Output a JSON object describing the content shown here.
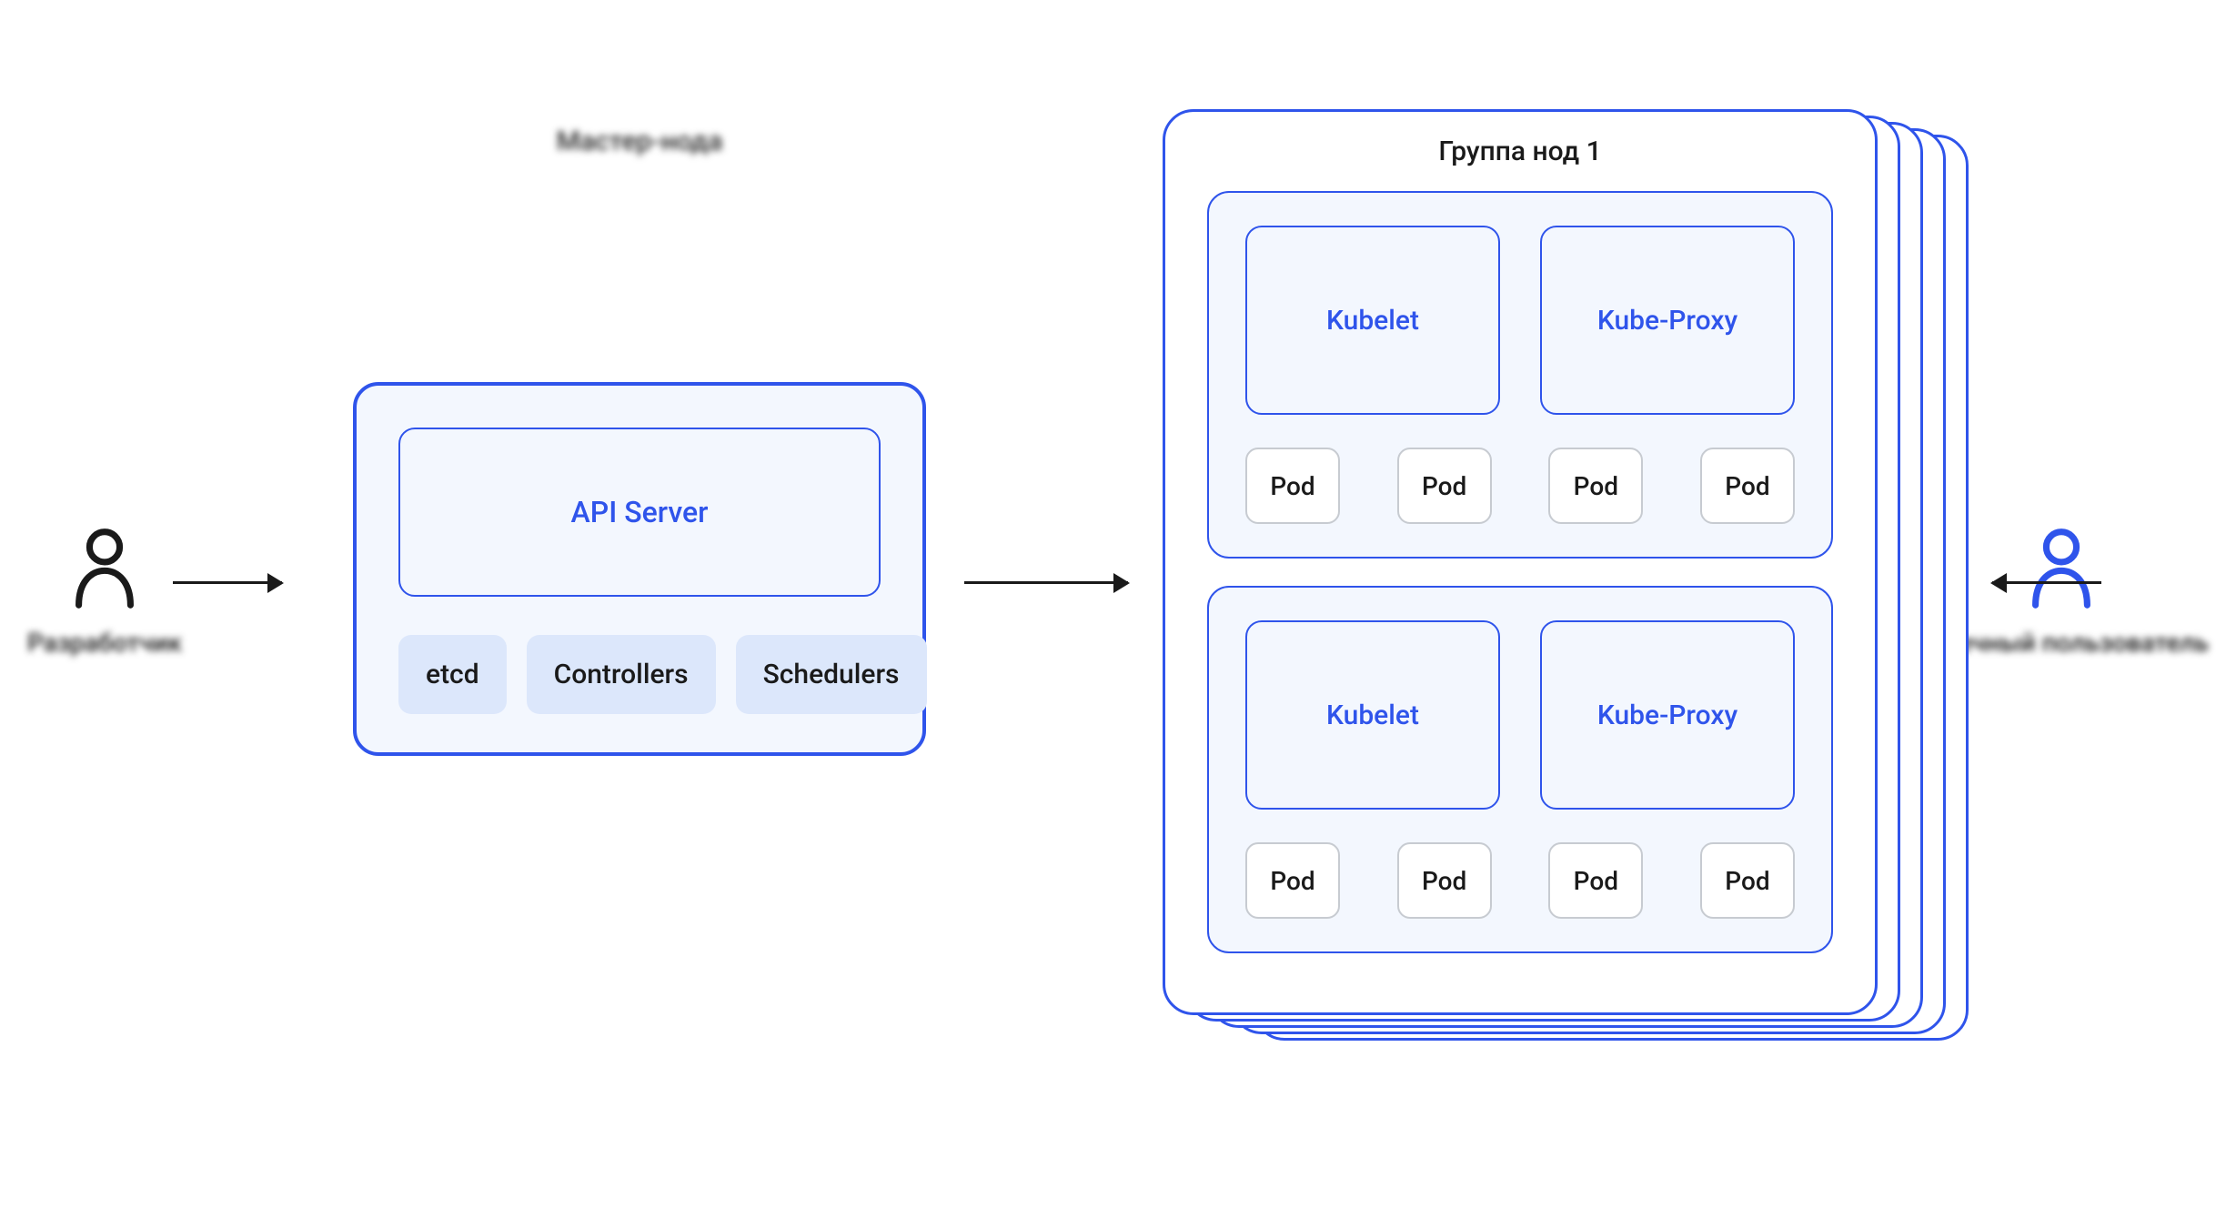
{
  "actors": {
    "left_label": "Разработчик",
    "right_label": "Конечный пользователь"
  },
  "master": {
    "title": "Мастер-нода",
    "api_server": "API Server",
    "components": {
      "etcd": "etcd",
      "controllers": "Controllers",
      "schedulers": "Schedulers"
    }
  },
  "node_group": {
    "title": "Группа нод 1",
    "nodes": [
      {
        "kubelet": "Kubelet",
        "kube_proxy": "Kube-Proxy",
        "pods": [
          "Pod",
          "Pod",
          "Pod",
          "Pod"
        ]
      },
      {
        "kubelet": "Kubelet",
        "kube_proxy": "Kube-Proxy",
        "pods": [
          "Pod",
          "Pod",
          "Pod",
          "Pod"
        ]
      }
    ]
  },
  "colors": {
    "primary": "#2F54EB",
    "light": "#F3F7FE",
    "pill": "#DCE7FB",
    "border_gray": "#C7CBD1",
    "text": "#1a1a1a"
  }
}
